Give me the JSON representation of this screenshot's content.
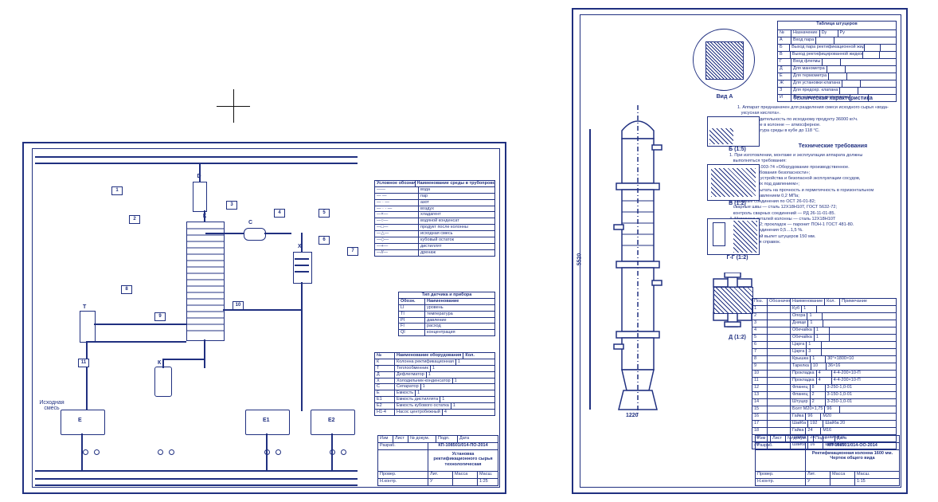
{
  "sheet_a": {
    "doc_number": "КП-108501/014-ПО-2014",
    "title": "Установка ректификационного сырья технологическая",
    "left_label": "Исходная смесь",
    "linesTable": {
      "header": [
        "Условное обознач.",
        "Наименование среды в трубопроводе"
      ],
      "rows": [
        [
          "——",
          "вода"
        ],
        [
          "— —",
          "пар"
        ],
        [
          "— · —",
          "азот"
        ],
        [
          "— · · —",
          "воздух"
        ],
        [
          "—×—",
          "хладагент"
        ],
        [
          "—○—",
          "водяной конденсат"
        ],
        [
          "—□—",
          "продукт после колонны"
        ],
        [
          "—△—",
          "исходная смесь"
        ],
        [
          "—◇—",
          "кубовый остаток"
        ],
        [
          "—+—",
          "дистиллят"
        ],
        [
          "—//—",
          "дренаж"
        ]
      ]
    },
    "sensorsTable": {
      "header": [
        "Тип датчика и прибора"
      ],
      "sub": [
        "Обозн.",
        "Наименование"
      ],
      "rows": [
        [
          "LI",
          "уровень"
        ],
        [
          "TI",
          "температура"
        ],
        [
          "PI",
          "давление"
        ],
        [
          "FI",
          "расход"
        ],
        [
          "QI",
          "концентрация"
        ]
      ]
    },
    "equipTable": {
      "header": [
        "№",
        "Наименование оборудования",
        "Кол."
      ],
      "rows": [
        [
          "К",
          "Колонна ректификационная",
          "1"
        ],
        [
          "Т",
          "Теплообменник",
          "1"
        ],
        [
          "Д",
          "Дефлегматор",
          "1"
        ],
        [
          "Х",
          "Холодильник-конденсатор",
          "1"
        ],
        [
          "С",
          "Сепаратор",
          "1"
        ],
        [
          "Е",
          "Емкость",
          "1"
        ],
        [
          "Е1",
          "Емкость дистиллята",
          "1"
        ],
        [
          "Е2",
          "Емкость кубового остатка",
          "1"
        ],
        [
          "Н1-4",
          "Насос центробежный",
          "4"
        ]
      ]
    },
    "title_block": {
      "row1": [
        "Изм",
        "Лист",
        "№ докум.",
        "Подп.",
        "Дата"
      ],
      "row2": [
        "Разраб.",
        "",
        "",
        ""
      ],
      "row3": [
        "Провер.",
        "",
        "",
        ""
      ],
      "row4": [
        "Н.контр.",
        "",
        "",
        ""
      ],
      "stage": "У",
      "mass": "",
      "scale": "1:25",
      "sheet": "1",
      "sheets": "2"
    }
  },
  "sheet_b": {
    "doc_number": "КП-108501/014-ОО-2014",
    "title": "Ректификационная колонна 1600 мм. Чертеж общего вида",
    "scale": "1:15",
    "partsTable": {
      "header": "Таблица штуцеров",
      "cols": [
        "№",
        "Назначение",
        "Dу",
        "Ру"
      ],
      "rows": [
        [
          "А",
          "Вход пара",
          "",
          ""
        ],
        [
          "Б",
          "Выход пара ректификационной жидкости",
          "",
          ""
        ],
        [
          "В",
          "Выход ректифицированной жидкости",
          "",
          ""
        ],
        [
          "Г",
          "Вход флегмы",
          "",
          ""
        ],
        [
          "Д",
          "Для манометра",
          "",
          ""
        ],
        [
          "Е",
          "Для термометра",
          "",
          ""
        ],
        [
          "Ж",
          "Для установки клапана",
          "",
          ""
        ],
        [
          "З",
          "Для предохр. клапана",
          "",
          ""
        ],
        [
          "И",
          "Для установки уровнемера",
          "",
          ""
        ]
      ]
    },
    "tech_char_title": "Техническая характеристика",
    "tech_char": "1. Аппарат предназначен для разделения смеси исходного сырья «вода-\n   уксусная кислота».\n2. Производительность по исходному продукту 36000 кг/ч.\n3. Давление в колонне — атмосферное.\n4. Температура среды в кубе до 118 °С.",
    "tech_req_title": "Технические требования",
    "tech_req": "1. При изготовлении, монтаже и эксплуатации аппарата должны\n   выполняться требования:\n   а) ГОСТ 12.2.003-74 «Оборудование производственное.\n      Общие требования безопасности»;\n   б) «Правила устройства и безопасной эксплуатации сосудов,\n      работающих под давлением»;\n2. Аппарат испытать на прочность и герметичность в горизонтальном\n   положении давлением 0,2 МПа;\n3. Сварные соединения по ОСТ 26-01-82;\n   сварные швы — сталь 12Х18Н10Т, ГОСТ 5632-72;\n   контроль сварных соединений — РД 26-11-01-85.\n4. Материал деталей колонны — сталь 12Х18Н10Т\n   ГОСТ 5632-72; прокладок — паронит ПОН-1 ГОСТ 481-80.\n5. Сварные соединения 0,5…1,5 %.\n6. Не указанный вылет штуцеров 150 мм.\n7. Размеры для справок.",
    "views": {
      "top": "Вид А",
      "b": "Б (1:5)",
      "c": "В (1:2)",
      "d": "Г-Г (1:2)",
      "e": "Д (1:2)"
    },
    "bom": {
      "header": [
        "Поз.",
        "Обозначение",
        "Наименование",
        "Кол.",
        "Примечание"
      ],
      "rows": [
        [
          "1",
          "",
          "Куб",
          "1",
          ""
        ],
        [
          "2",
          "",
          "Опора",
          "1",
          ""
        ],
        [
          "3",
          "",
          "Днище",
          "1",
          ""
        ],
        [
          "4",
          "",
          "Обечайка",
          "1",
          ""
        ],
        [
          "5",
          "",
          "Обечайка",
          "1",
          ""
        ],
        [
          "6",
          "",
          "Царга",
          "1",
          ""
        ],
        [
          "7",
          "",
          "Царга",
          "3",
          ""
        ],
        [
          "8",
          "",
          "Крышка",
          "1",
          "30°×1800×10"
        ],
        [
          "9",
          "",
          "Тарелка",
          "10",
          "36×16"
        ],
        [
          "10",
          "",
          "Прокладка",
          "4",
          "4-4-200×10-П"
        ],
        [
          "11",
          "",
          "Прокладка",
          "4",
          "4-4-200×10-П"
        ],
        [
          "12",
          "",
          "Фланец",
          "8",
          "3-250-1,0-01"
        ],
        [
          "13",
          "",
          "Фланец",
          "2",
          "3-150-1,0-01"
        ],
        [
          "14",
          "",
          "Штуцер",
          "2",
          "3-250-1,0-01"
        ],
        [
          "15",
          "",
          "Болт М20×1,75",
          "96",
          ""
        ],
        [
          "16",
          "",
          "Гайка",
          "96",
          "М20"
        ],
        [
          "17",
          "",
          "Шайба",
          "192",
          "Шайба 20"
        ],
        [
          "18",
          "",
          "Гайка",
          "24",
          "М16"
        ],
        [
          "19",
          "",
          "Шайба",
          "24",
          "Шайба 16"
        ],
        [
          "20",
          "",
          "Шайба",
          "16",
          "Шайба 20"
        ]
      ]
    },
    "title_block": {
      "row1": [
        "Изм",
        "Лист",
        "№ докум.",
        "Подп.",
        "Дата"
      ],
      "row2": [
        "Разраб.",
        "",
        "",
        ""
      ],
      "row3": [
        "Провер.",
        "",
        "",
        ""
      ],
      "row4": [
        "Н.контр.",
        "",
        "",
        ""
      ],
      "stage": "У",
      "mass": "",
      "scale": "1:15",
      "sheet": "2",
      "sheets": "2"
    }
  }
}
